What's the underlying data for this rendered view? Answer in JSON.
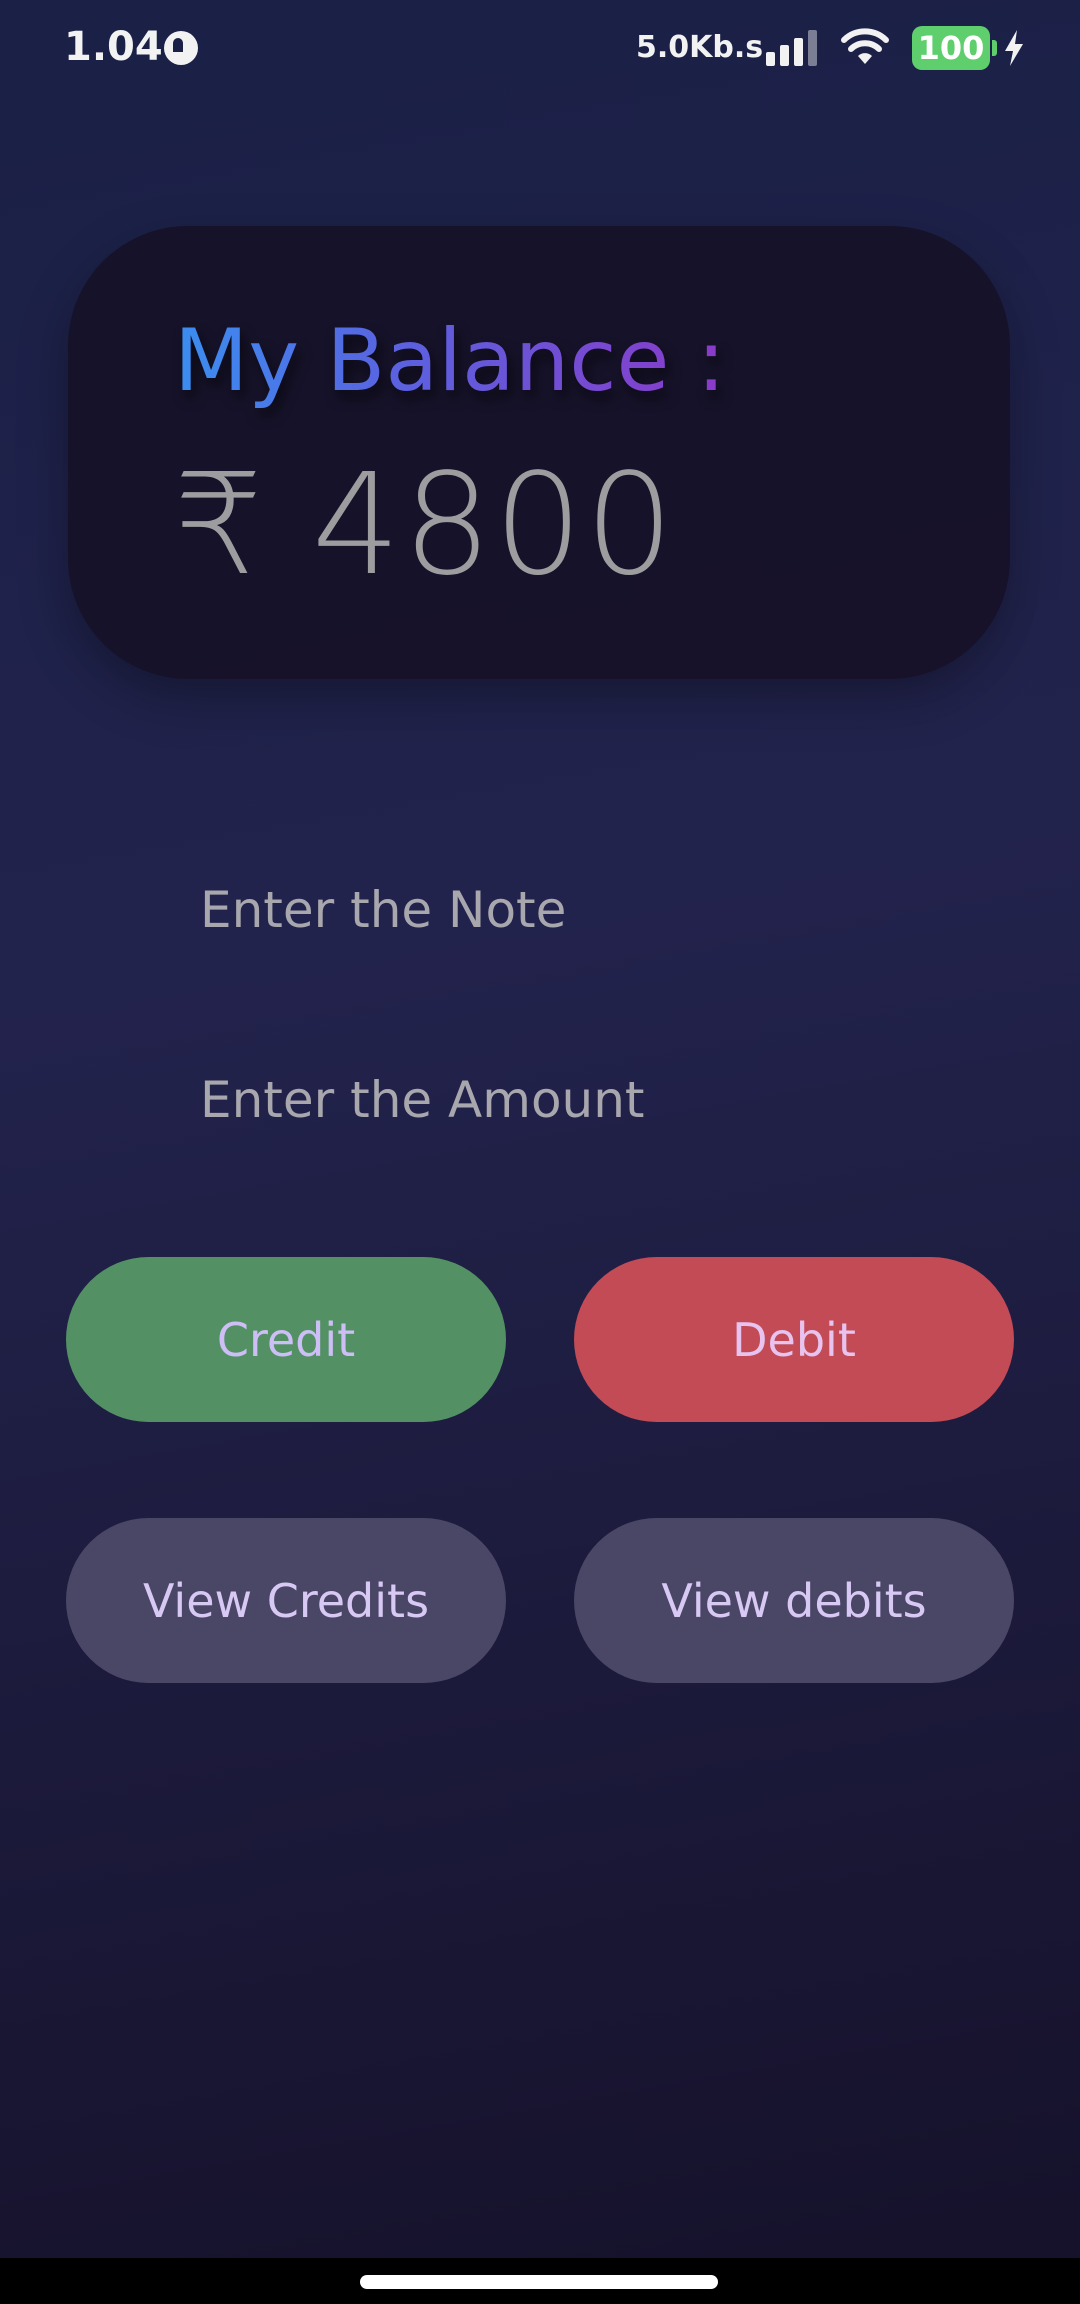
{
  "status_bar": {
    "time": "1.04",
    "network_speed": "5.0Kb.s",
    "battery_level": "100",
    "icons": [
      "app-notification-icon",
      "signal-icon",
      "wifi-icon",
      "battery-icon",
      "charging-icon"
    ]
  },
  "balance": {
    "label": "My Balance :",
    "amount": "₹ 4800"
  },
  "form": {
    "note_placeholder": "Enter the Note",
    "amount_placeholder": "Enter the Amount"
  },
  "actions": {
    "credit_label": "Credit",
    "debit_label": "Debit",
    "view_credits_label": "View Credits",
    "view_debits_label": "View debits"
  },
  "colors": {
    "background": "#1c1f45",
    "card": "#161024",
    "credit": "#539165",
    "debit": "#c24b56",
    "secondary_button": "#4a4766",
    "balance_gradient_start": "#3a8ef0",
    "balance_gradient_end": "#8a3ac8"
  }
}
